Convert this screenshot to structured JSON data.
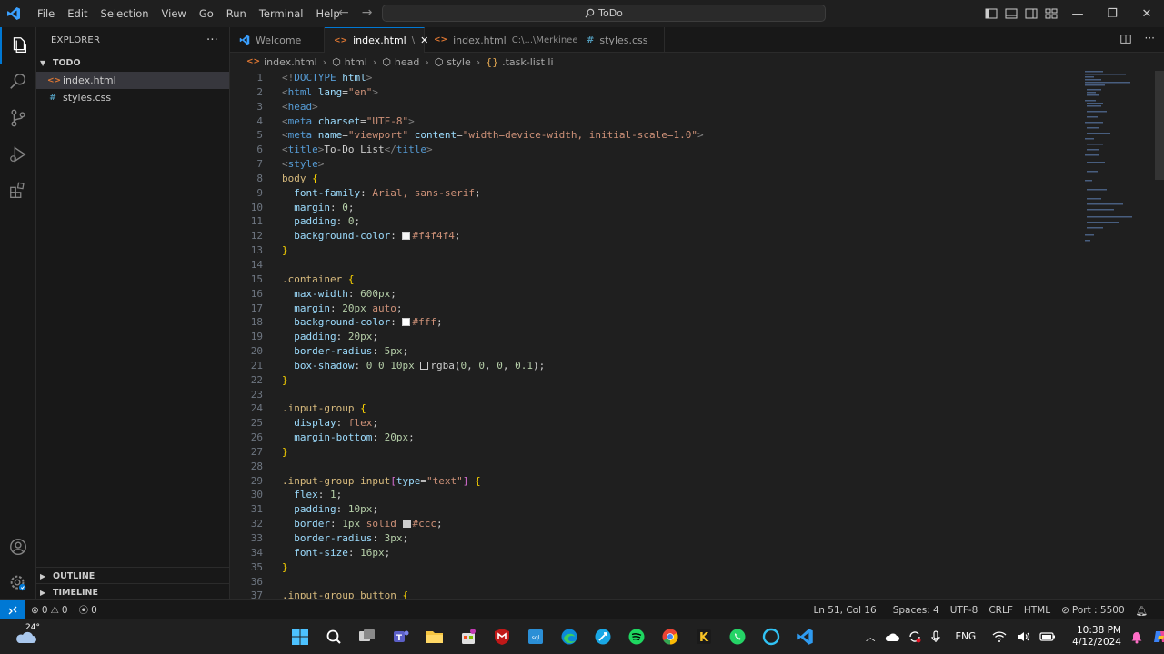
{
  "titlebar": {
    "menu": [
      "File",
      "Edit",
      "Selection",
      "View",
      "Go",
      "Run",
      "Terminal",
      "Help"
    ],
    "search_text": "ToDo"
  },
  "sidebar": {
    "title": "EXPLORER",
    "folder": "TODO",
    "files": [
      {
        "name": "index.html",
        "type": "html",
        "selected": true
      },
      {
        "name": "styles.css",
        "type": "css",
        "selected": false
      }
    ],
    "outline": "OUTLINE",
    "timeline": "TIMELINE"
  },
  "tabs": [
    {
      "label": "Welcome",
      "path": "",
      "active": false
    },
    {
      "label": "index.html",
      "path": "\\",
      "active": true
    },
    {
      "label": "index.html",
      "path": "C:\\...\\Merkinee",
      "active": false
    },
    {
      "label": "styles.css",
      "path": "",
      "active": false
    }
  ],
  "breadcrumb": [
    "index.html",
    "html",
    "head",
    "style",
    ".task-list li"
  ],
  "editor": {
    "line_numbers": [
      "1",
      "2",
      "3",
      "4",
      "5",
      "6",
      "7",
      "8",
      "9",
      "10",
      "11",
      "12",
      "13",
      "14",
      "15",
      "16",
      "17",
      "18",
      "19",
      "20",
      "21",
      "22",
      "23",
      "24",
      "25",
      "26",
      "27",
      "28",
      "29",
      "30",
      "31",
      "32",
      "33",
      "34",
      "35",
      "36",
      "37"
    ]
  },
  "statusbar": {
    "errors": "0",
    "warnings": "0",
    "ports_info": "0",
    "position": "Ln 51, Col 16",
    "spaces": "Spaces: 4",
    "encoding": "UTF-8",
    "eol": "CRLF",
    "language": "HTML",
    "port": "Port : 5500"
  },
  "taskbar": {
    "temperature": "24°",
    "language": "ENG",
    "time": "10:38 PM",
    "date": "4/12/2024"
  },
  "colors": {
    "accent": "#0078d4",
    "editor_bg": "#1f1f1f",
    "sidebar_bg": "#181818"
  }
}
